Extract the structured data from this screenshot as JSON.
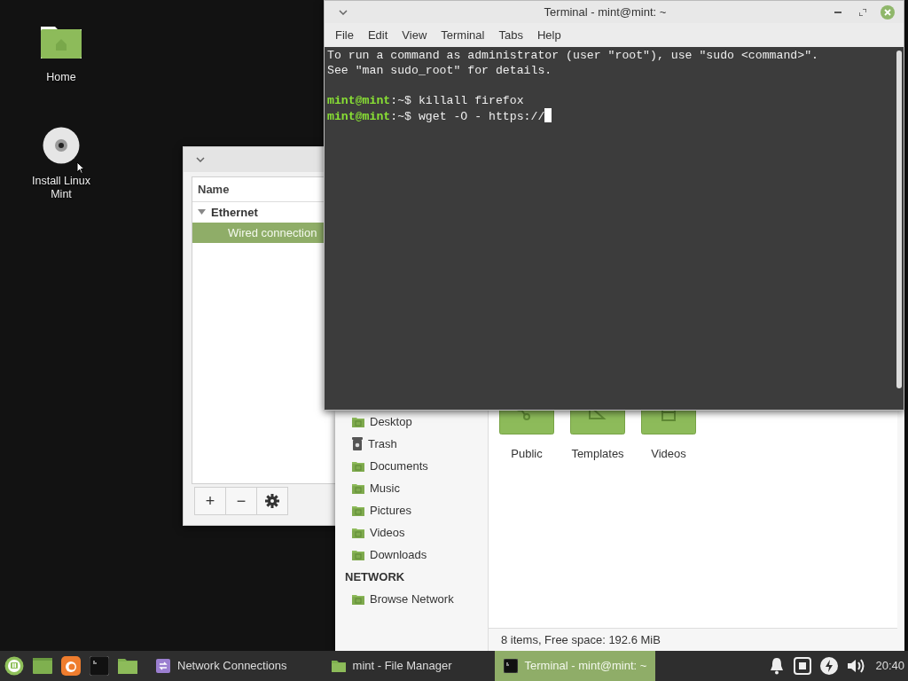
{
  "desktop_icons": [
    {
      "label": "Home",
      "kind": "folder"
    },
    {
      "label": "Install Linux Mint",
      "kind": "disc"
    }
  ],
  "network_window": {
    "column_header": "Name",
    "groups": [
      {
        "label": "Ethernet",
        "expanded": true,
        "children": [
          {
            "label": "Wired connection",
            "selected": true
          }
        ]
      }
    ],
    "toolbar": [
      {
        "kind": "text",
        "label": "+"
      },
      {
        "kind": "text",
        "label": "−"
      },
      {
        "kind": "gear"
      }
    ]
  },
  "file_manager": {
    "sidebar": [
      {
        "kind": "folder",
        "label": "Desktop"
      },
      {
        "kind": "trash",
        "label": "Trash"
      },
      {
        "kind": "folder",
        "label": "Documents"
      },
      {
        "kind": "folder",
        "label": "Music"
      },
      {
        "kind": "folder",
        "label": "Pictures"
      },
      {
        "kind": "folder",
        "label": "Videos"
      },
      {
        "kind": "folder",
        "label": "Downloads"
      },
      {
        "kind": "heading",
        "label": "NETWORK"
      },
      {
        "kind": "folder",
        "label": "Browse Network"
      }
    ],
    "files": [
      {
        "label": "Public",
        "kind": "share"
      },
      {
        "label": "Templates",
        "kind": "template"
      },
      {
        "label": "Videos",
        "kind": "video"
      }
    ],
    "status_bar": "8 items, Free space: 192.6 MiB"
  },
  "terminal": {
    "title": "Terminal - mint@mint: ~",
    "menu": [
      "File",
      "Edit",
      "View",
      "Terminal",
      "Tabs",
      "Help"
    ],
    "lines": [
      {
        "kind": "text",
        "text": "To run a command as administrator (user \"root\"), use \"sudo <command>\"."
      },
      {
        "kind": "text",
        "text": "See \"man sudo_root\" for details."
      },
      {
        "kind": "blank"
      },
      {
        "kind": "prompt",
        "user": "mint@mint",
        "path": ":~$",
        "command": "killall firefox",
        "cursor": false
      },
      {
        "kind": "prompt",
        "user": "mint@mint",
        "path": ":~$",
        "command": "wget -O - https://",
        "cursor": true
      }
    ]
  },
  "taskbar": {
    "launchers": [
      {
        "kind": "menu"
      },
      {
        "kind": "desktop"
      },
      {
        "kind": "browser"
      },
      {
        "kind": "terminal"
      },
      {
        "kind": "folder"
      }
    ],
    "windows": [
      {
        "label": "Network Connections",
        "kind": "network",
        "selected": false
      },
      {
        "label": "mint - File Manager",
        "kind": "folder",
        "selected": false
      },
      {
        "label": "Terminal - mint@mint: ~",
        "kind": "terminal",
        "selected": true
      }
    ],
    "clock": "20:40"
  }
}
